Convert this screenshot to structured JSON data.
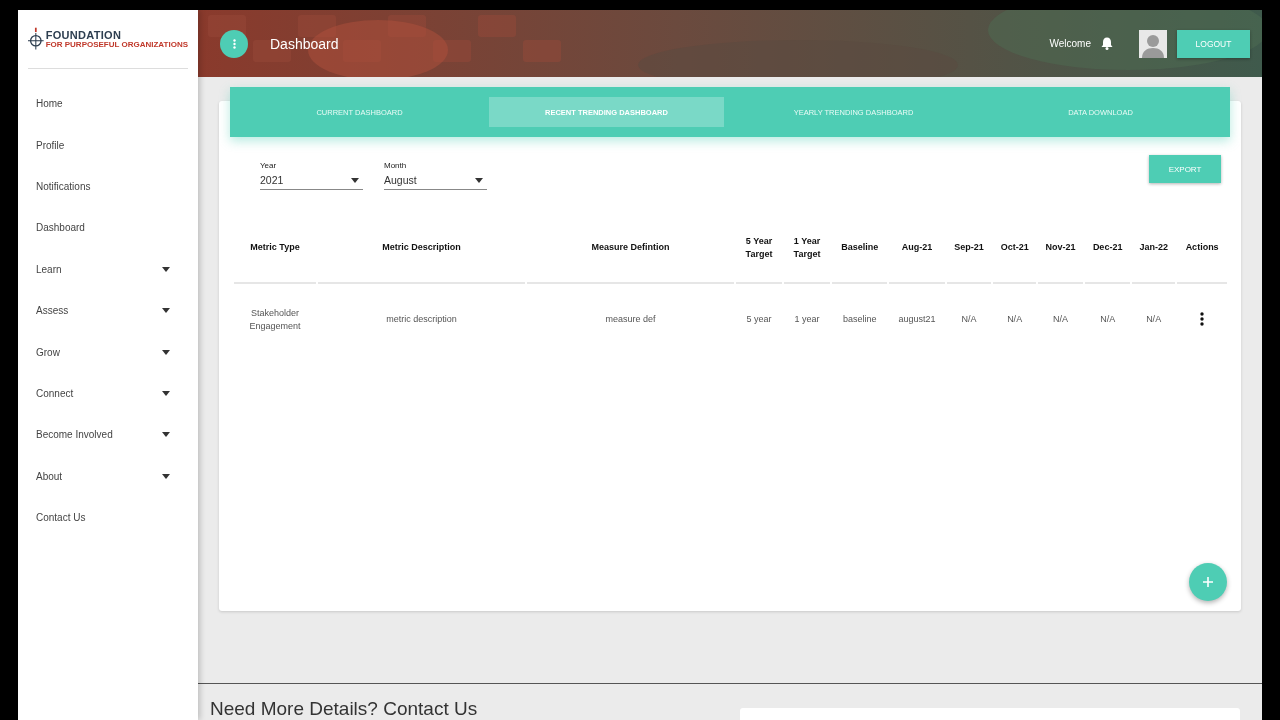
{
  "logo": {
    "name": "FOUNDATION",
    "tagline": "FOR PURPOSEFUL ORGANIZATIONS"
  },
  "sidebar": {
    "items": [
      {
        "label": "Home",
        "kind": "link"
      },
      {
        "label": "Profile",
        "kind": "link"
      },
      {
        "label": "Notifications",
        "kind": "link"
      },
      {
        "label": "Dashboard",
        "kind": "link"
      },
      {
        "label": "Learn",
        "kind": "menu"
      },
      {
        "label": "Assess",
        "kind": "menu"
      },
      {
        "label": "Grow",
        "kind": "menu"
      },
      {
        "label": "Connect",
        "kind": "menu"
      },
      {
        "label": "Become Involved",
        "kind": "menu"
      },
      {
        "label": "About",
        "kind": "menu"
      },
      {
        "label": "Contact Us",
        "kind": "link"
      }
    ]
  },
  "header": {
    "title": "Dashboard",
    "welcome": "Welcome",
    "logout": "LOGOUT"
  },
  "tabs": [
    {
      "label": "CURRENT DASHBOARD",
      "selected": false
    },
    {
      "label": "RECENT TRENDING DASHBOARD",
      "selected": true
    },
    {
      "label": "YEARLY TRENDING DASHBOARD",
      "selected": false
    },
    {
      "label": "DATA DOWNLOAD",
      "selected": false
    }
  ],
  "filters": [
    {
      "label": "Year",
      "value": "2021"
    },
    {
      "label": "Month",
      "value": "August"
    }
  ],
  "export": "EXPORT",
  "table": {
    "columns": [
      "Metric Type",
      "Metric Description",
      "Measure Defintion",
      "5 Year Target",
      "1 Year Target",
      "Baseline",
      "Aug-21",
      "Sep-21",
      "Oct-21",
      "Nov-21",
      "Dec-21",
      "Jan-22",
      "Actions"
    ],
    "rows": [
      {
        "cells": [
          "Stakeholder Engagement",
          "metric description",
          "measure def",
          "5 year",
          "1 year",
          "baseline",
          "august21",
          "N/A",
          "N/A",
          "N/A",
          "N/A",
          "N/A"
        ]
      }
    ]
  },
  "footer": {
    "heading": "Need More Details? Contact Us"
  }
}
